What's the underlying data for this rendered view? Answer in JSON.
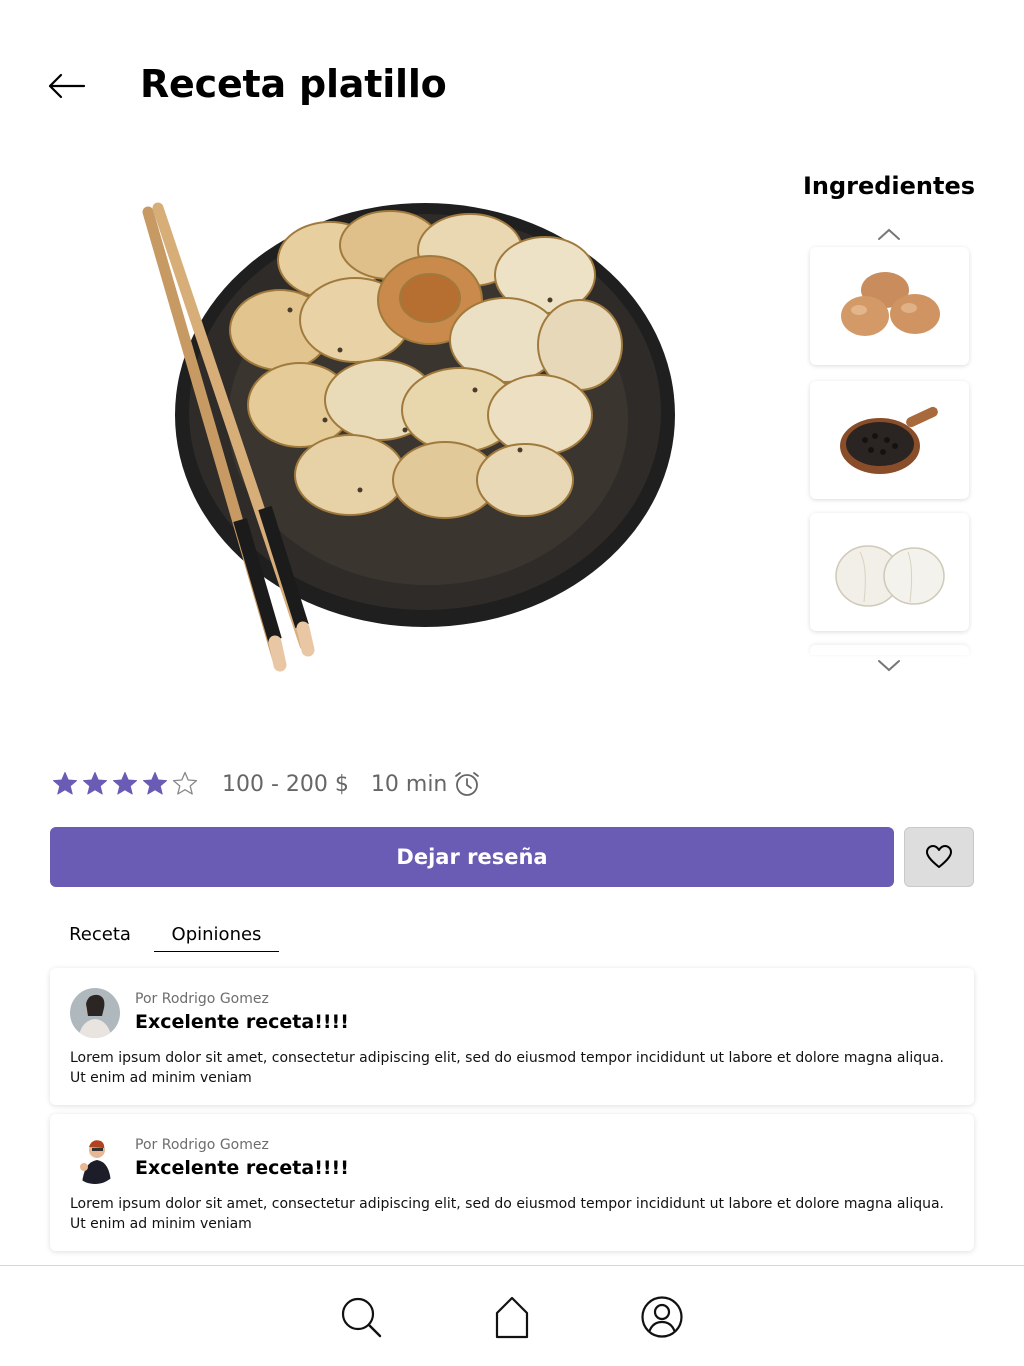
{
  "header": {
    "title": "Receta platillo"
  },
  "ingredients": {
    "title": "Ingredientes",
    "items": [
      {
        "name": "Huevos",
        "icon": "eggs-image"
      },
      {
        "name": "Pimienta",
        "icon": "pepper-image"
      },
      {
        "name": "Cebolla",
        "icon": "onion-image"
      }
    ]
  },
  "meta": {
    "rating": 4,
    "rating_max": 5,
    "price": "100 - 200 $",
    "time": "10 min"
  },
  "actions": {
    "review_label": "Dejar reseña"
  },
  "tabs": [
    {
      "label": "Receta",
      "active": false
    },
    {
      "label": "Opiniones",
      "active": true
    }
  ],
  "reviews": [
    {
      "author": "Por Rodrigo Gomez",
      "title": "Excelente receta!!!!",
      "body": "Lorem ipsum dolor sit amet, consectetur adipiscing elit, sed do eiusmod tempor incididunt ut labore et dolore magna aliqua. Ut enim ad minim veniam"
    },
    {
      "author": "Por Rodrigo Gomez",
      "title": "Excelente receta!!!!",
      "body": "Lorem ipsum dolor sit amet, consectetur adipiscing elit, sed do eiusmod tempor incididunt ut labore et dolore magna aliqua. Ut enim ad minim veniam"
    }
  ],
  "colors": {
    "accent": "#6a5bb5",
    "favorite_bg": "#dddddd"
  }
}
